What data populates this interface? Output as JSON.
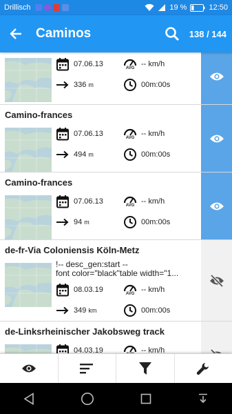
{
  "status_bar": {
    "carrier": "Drillisch",
    "battery_percent": "19 %",
    "time": "12:50",
    "app_badges": [
      "#4f7ff0",
      "#8e56d8",
      "#e53935",
      "#5b8ee8"
    ]
  },
  "app_bar": {
    "title": "Caminos",
    "counter": "138 / 144"
  },
  "list": {
    "avg_label": "AVG",
    "items": [
      {
        "title": "",
        "desc_lines": [],
        "date": "07.06.13",
        "speed": "-- km/h",
        "distance_value": "336",
        "distance_unit": "m",
        "duration": "00m:00s",
        "visible": true
      },
      {
        "title": "Camino-frances",
        "desc_lines": [],
        "date": "07.06.13",
        "speed": "-- km/h",
        "distance_value": "494",
        "distance_unit": "m",
        "duration": "00m:00s",
        "visible": true
      },
      {
        "title": "Camino-frances",
        "desc_lines": [],
        "date": "07.06.13",
        "speed": "-- km/h",
        "distance_value": "94",
        "distance_unit": "m",
        "duration": "00m:00s",
        "visible": true
      },
      {
        "title": "de-fr-Via Coloniensis Köln-Metz",
        "desc_lines": [
          "!-- desc_gen:start --",
          "font color=\"black\"table width=\"1..."
        ],
        "date": "08.03.19",
        "speed": "-- km/h",
        "distance_value": "349",
        "distance_unit": "km",
        "duration": "00m:00s",
        "visible": false
      },
      {
        "title": "de-Linksrheinischer Jakobsweg track",
        "desc_lines": [],
        "date": "04.03.19",
        "speed": "-- km/h",
        "distance_value": "",
        "distance_unit": "",
        "duration": "",
        "visible": false
      }
    ]
  },
  "bottom_toolbar": {
    "buttons": [
      "eye-icon",
      "sort-icon",
      "filter-icon",
      "wrench-icon"
    ]
  },
  "nav_bar": {
    "buttons": [
      "back-triangle-icon",
      "home-circle-icon",
      "recents-square-icon",
      "download-arrow-icon"
    ]
  },
  "colors": {
    "status_bar": "#1e88e5",
    "app_bar": "#2196f3",
    "visible_column": "#5aa5e8",
    "hidden_column": "#f1f1f1",
    "hidden_eye": "#555555"
  }
}
